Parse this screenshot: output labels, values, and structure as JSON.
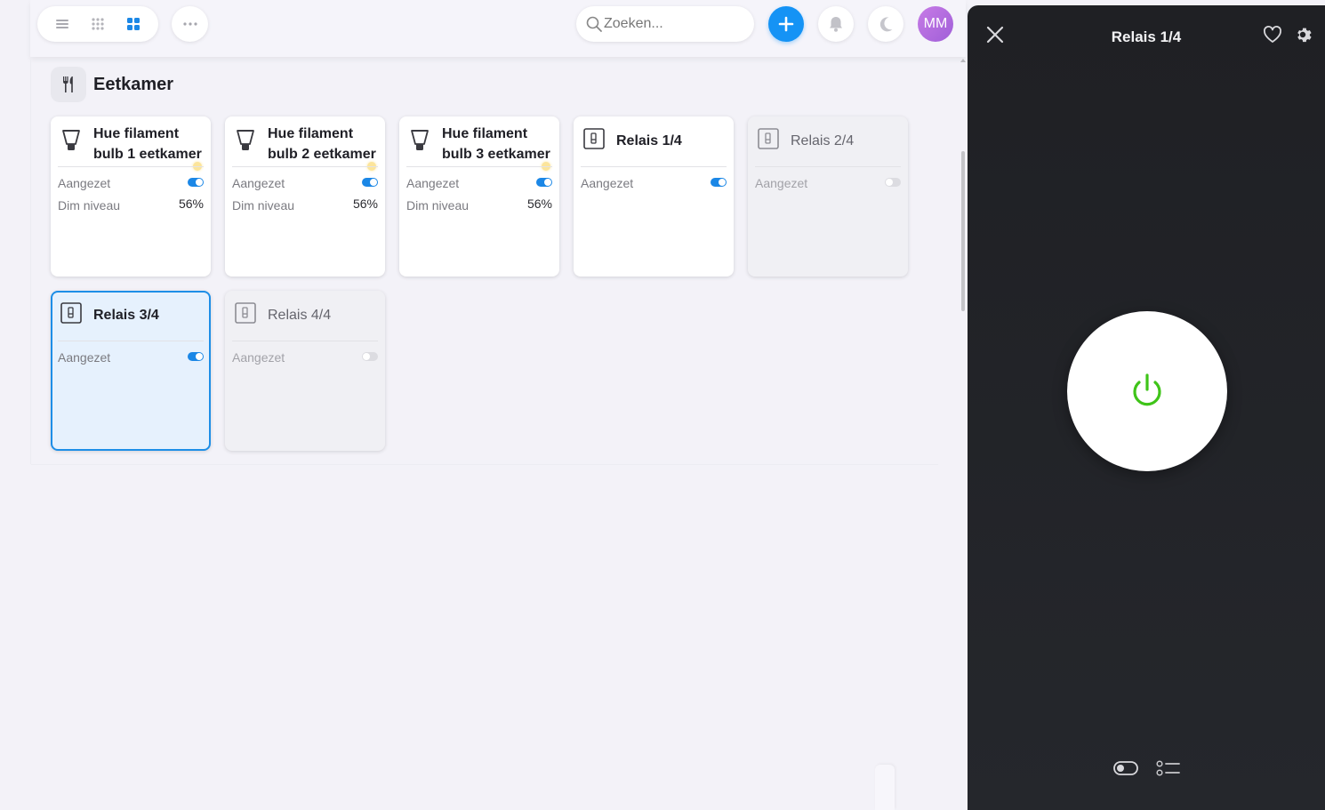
{
  "topbar": {
    "view_modes": [
      "list-view-icon",
      "compact-grid-view-icon",
      "grid-view-icon"
    ],
    "active_view": "grid-view-icon",
    "search_placeholder": "Zoeken...",
    "avatar_initials": "MM",
    "accent_color": "#1593f5"
  },
  "room": {
    "title": "Eetkamer",
    "icon": "fork-knife-icon"
  },
  "devices": [
    {
      "title": "Hue filament bulb 1 eetkamer",
      "icon": "bulb-icon",
      "state_label": "Aangezet",
      "state": "on",
      "dim_label": "Dim niveau",
      "dim_value": "56%"
    },
    {
      "title": "Hue filament bulb 2 eetkamer",
      "icon": "bulb-icon",
      "state_label": "Aangezet",
      "state": "on",
      "dim_label": "Dim niveau",
      "dim_value": "56%"
    },
    {
      "title": "Hue filament bulb 3 eetkamer",
      "icon": "bulb-icon",
      "state_label": "Aangezet",
      "state": "on",
      "dim_label": "Dim niveau",
      "dim_value": "56%"
    },
    {
      "title": "Relais 1/4",
      "icon": "relay-icon",
      "state_label": "Aangezet",
      "state": "on"
    },
    {
      "title": "Relais 2/4",
      "icon": "relay-icon",
      "state_label": "Aangezet",
      "state": "off"
    },
    {
      "title": "Relais 3/4",
      "icon": "relay-icon",
      "state_label": "Aangezet",
      "state": "on",
      "selected": true
    },
    {
      "title": "Relais 4/4",
      "icon": "relay-icon",
      "state_label": "Aangezet",
      "state": "off"
    }
  ],
  "panel": {
    "title": "Relais 1/4",
    "power_state": "on",
    "power_color": "#3fc419"
  }
}
